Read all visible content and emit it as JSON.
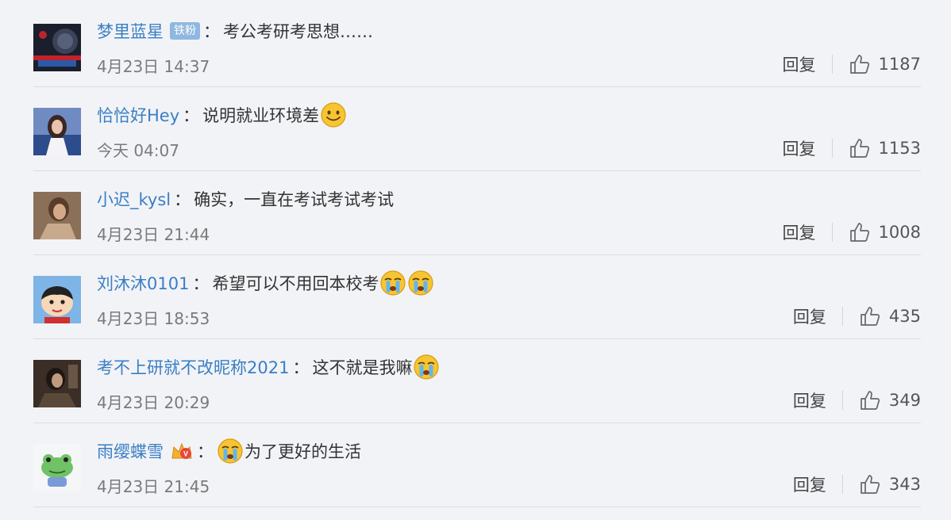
{
  "comments": [
    {
      "username": "梦里蓝星",
      "badge": "铁粉",
      "colon": "：",
      "text": "考公考研考思想……",
      "time": "4月23日 14:37",
      "reply_label": "回复",
      "likes": "1187",
      "avatar_icon": "avatar-dark-planet",
      "emojis": []
    },
    {
      "username": "恰恰好Hey",
      "colon": "：",
      "text": "说明就业环境差",
      "time": "今天 04:07",
      "reply_label": "回复",
      "likes": "1153",
      "avatar_icon": "avatar-girl-photo",
      "emojis": [
        "smile-emoji"
      ]
    },
    {
      "username": "小迟_kysl",
      "colon": "：",
      "text": "确实，一直在考试考试考试",
      "time": "4月23日 21:44",
      "reply_label": "回复",
      "likes": "1008",
      "avatar_icon": "avatar-person-photo",
      "emojis": []
    },
    {
      "username": "刘沐沐0101",
      "colon": "：",
      "text": "希望可以不用回本校考",
      "time": "4月23日 18:53",
      "reply_label": "回复",
      "likes": "435",
      "avatar_icon": "avatar-cartoon-boy",
      "emojis": [
        "crying-emoji",
        "crying-emoji"
      ]
    },
    {
      "username": "考不上研就不改昵称2021",
      "colon": "：",
      "text": "这不就是我嘛",
      "time": "4月23日 20:29",
      "reply_label": "回复",
      "likes": "349",
      "avatar_icon": "avatar-dark-photo",
      "emojis": [
        "crying-emoji"
      ]
    },
    {
      "username": "雨缨蝶雪",
      "colon": "：",
      "text": "为了更好的生活",
      "time": "4月23日 21:45",
      "reply_label": "回复",
      "likes": "343",
      "avatar_icon": "avatar-green-frog",
      "vip_icon": "vip-crown-icon",
      "lead_emojis": [
        "crying-emoji"
      ],
      "emojis": []
    }
  ],
  "colors": {
    "username": "#3a7fc4",
    "background": "#f2f3f7",
    "text": "#333333",
    "timestamp": "#7a7a7a"
  }
}
